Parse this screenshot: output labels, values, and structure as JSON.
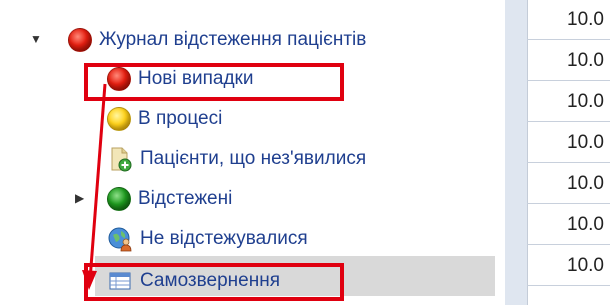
{
  "tree": {
    "root": {
      "label": "Журнал відстеження пацієнтів",
      "icon": "red-circle-icon",
      "expanded": true
    },
    "items": [
      {
        "label": "Нові випадки",
        "icon": "red-circle-icon"
      },
      {
        "label": "В процесі",
        "icon": "yellow-circle-icon"
      },
      {
        "label": "Пацієнти, що нез'явилися",
        "icon": "document-add-icon"
      },
      {
        "label": "Відстежені",
        "icon": "green-circle-icon",
        "collapsed": true
      },
      {
        "label": "Не відстежувалися",
        "icon": "globe-person-icon"
      },
      {
        "label": "Самозвернення",
        "icon": "list-grid-icon",
        "selected": true
      }
    ]
  },
  "grid": {
    "cells": [
      "10.0",
      "10.0",
      "10.0",
      "10.0",
      "10.0",
      "10.0",
      "10.0"
    ]
  },
  "colors": {
    "label": "#1f3f8f",
    "highlight": "#e00010",
    "selection": "#d9d9d9"
  }
}
